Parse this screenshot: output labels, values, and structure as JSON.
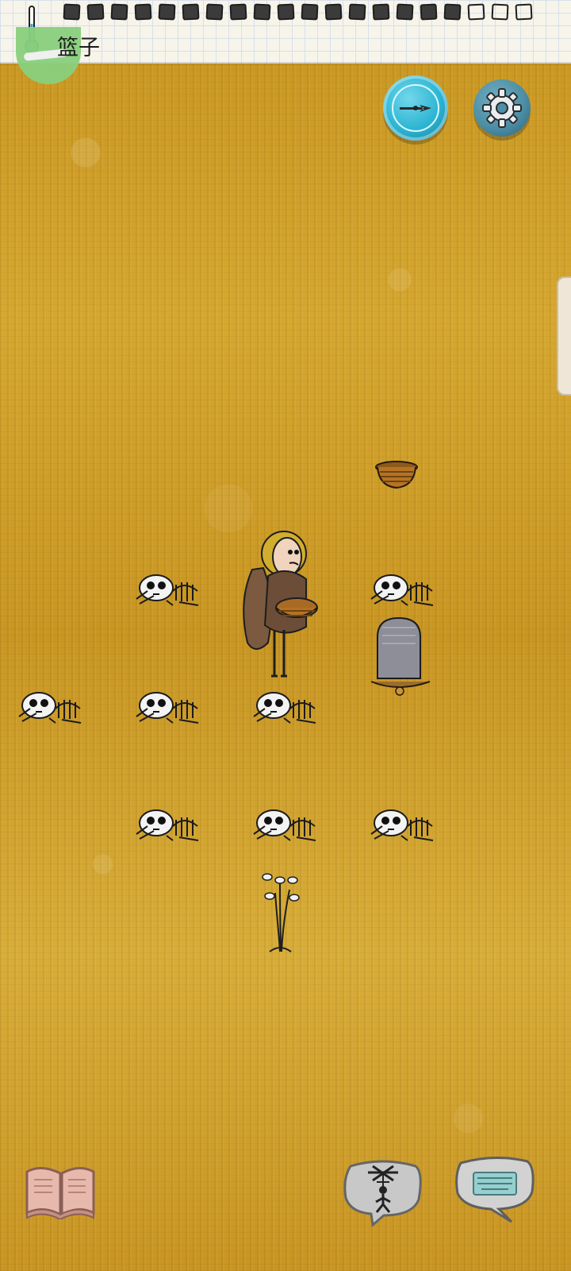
{
  "hud": {
    "held_item_label": "篮子",
    "watermark_text": "",
    "food_pips_total": 20,
    "food_pips_filled": 17
  },
  "buttons": {
    "compass_icon": "compass-arrow-icon",
    "settings_icon": "gear-icon",
    "book_icon": "book-icon",
    "emote_icon": "puppet-emote-icon",
    "keyboard_icon": "keyboard-chat-icon"
  },
  "world": {
    "objects": [
      {
        "type": "basket",
        "name": "basket"
      },
      {
        "type": "skeleton",
        "name": "skeleton-1"
      },
      {
        "type": "skeleton",
        "name": "skeleton-2"
      },
      {
        "type": "skeleton",
        "name": "skeleton-3"
      },
      {
        "type": "skeleton",
        "name": "skeleton-4"
      },
      {
        "type": "skeleton",
        "name": "skeleton-5"
      },
      {
        "type": "skeleton",
        "name": "skeleton-6"
      },
      {
        "type": "skeleton",
        "name": "skeleton-7"
      },
      {
        "type": "skeleton",
        "name": "skeleton-8"
      },
      {
        "type": "gravestone",
        "name": "gravestone"
      },
      {
        "type": "plant",
        "name": "white-flower-plant"
      },
      {
        "type": "player",
        "name": "player-character"
      }
    ]
  },
  "colors": {
    "grass": "#d2a12a",
    "paper_bar": "#f7f4ea",
    "compass_blue": "#2bb4d2",
    "gear_blue": "#4d8fa7",
    "book_pink": "#e5b7ab",
    "keyboard_teal": "#95cfd0"
  }
}
